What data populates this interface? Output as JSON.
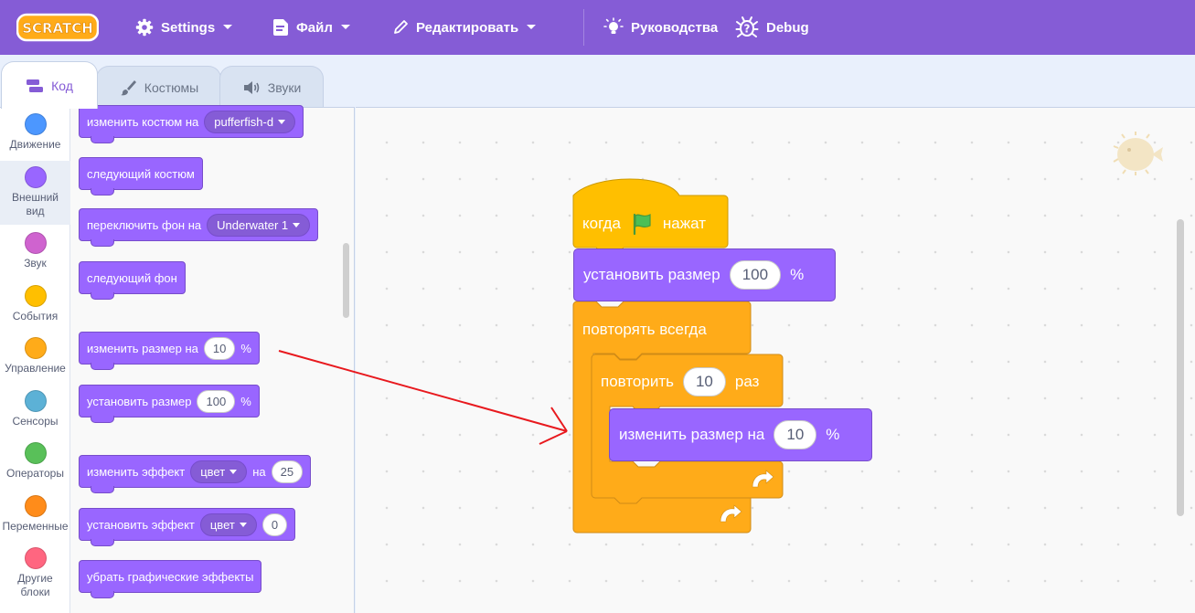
{
  "menu": {
    "logo_text": "SCRATCH",
    "settings": "Settings",
    "file": "Файл",
    "edit": "Редактировать",
    "tutorials": "Руководства",
    "debug": "Debug"
  },
  "tabs": {
    "code": "Код",
    "costumes": "Костюмы",
    "sounds": "Звуки"
  },
  "categories": [
    {
      "label": "Движение",
      "color": "#4c97ff"
    },
    {
      "label": "Внешний вид",
      "color": "#9966ff"
    },
    {
      "label": "Звук",
      "color": "#cf63cf"
    },
    {
      "label": "События",
      "color": "#ffbf00"
    },
    {
      "label": "Управление",
      "color": "#ffab19"
    },
    {
      "label": "Сенсоры",
      "color": "#5cb1d6"
    },
    {
      "label": "Операторы",
      "color": "#59c059"
    },
    {
      "label": "Переменные",
      "color": "#ff8c1a"
    },
    {
      "label": "Другие блоки",
      "color": "#ff6680"
    }
  ],
  "palette": {
    "switch_costume": "изменить костюм на",
    "switch_costume_value": "pufferfish-d",
    "next_costume": "следующий костюм",
    "switch_backdrop": "переключить фон на",
    "switch_backdrop_value": "Underwater 1",
    "next_backdrop": "следующий фон",
    "change_size": "изменить размер на",
    "change_size_value": "10",
    "set_size": "установить размер",
    "set_size_value": "100",
    "percent": "%",
    "change_effect": "изменить эффект",
    "change_effect_dropdown": "цвет",
    "change_effect_by": "на",
    "change_effect_value": "25",
    "set_effect": "установить эффект",
    "set_effect_dropdown": "цвет",
    "set_effect_value": "0",
    "clear_effects": "убрать графические эффекты"
  },
  "script": {
    "when_flag": "когда",
    "when_flag_suffix": "нажат",
    "set_size": "установить размер",
    "set_size_value": "100",
    "set_size_unit": "%",
    "forever": "повторять всегда",
    "repeat": "повторить",
    "repeat_value": "10",
    "repeat_suffix": "раз",
    "change_size": "изменить размер на",
    "change_size_value": "10",
    "change_size_unit": "%"
  },
  "colors": {
    "menu_bar": "#855cd6",
    "looks": "#9966ff",
    "events": "#ffbf00",
    "control": "#ffab19",
    "annotation_arrow": "#e8191e"
  },
  "icons": {
    "settings": "gear-icon",
    "file": "file-icon",
    "edit": "pencil-icon",
    "tutorials": "lightbulb-icon",
    "debug": "bug-icon",
    "green_flag": "green-flag-icon",
    "sprite": "pufferfish-sprite-icon"
  }
}
